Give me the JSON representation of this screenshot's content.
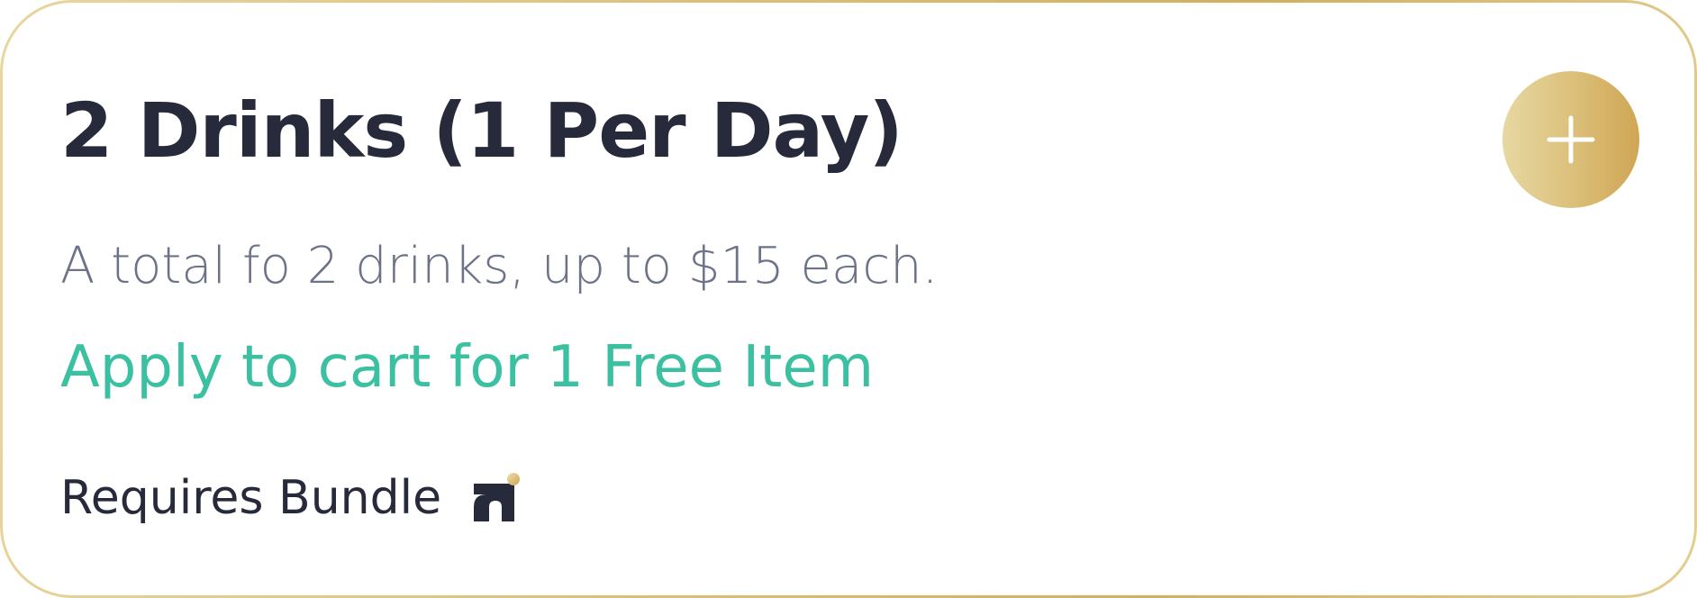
{
  "offer": {
    "title": "2 Drinks (1 Per Day)",
    "description": "A total fo 2 drinks, up to $15 each.",
    "apply_label": "Apply to cart for 1 Free Item",
    "requires_label": "Requires Bundle"
  },
  "icons": {
    "add": "plus-icon",
    "bundle": "bundle-logo-icon"
  },
  "colors": {
    "title": "#272a3a",
    "description": "#6c7389",
    "apply": "#3cc0a2",
    "gold_light": "#e6d8a2",
    "gold_dark": "#cfa654"
  }
}
